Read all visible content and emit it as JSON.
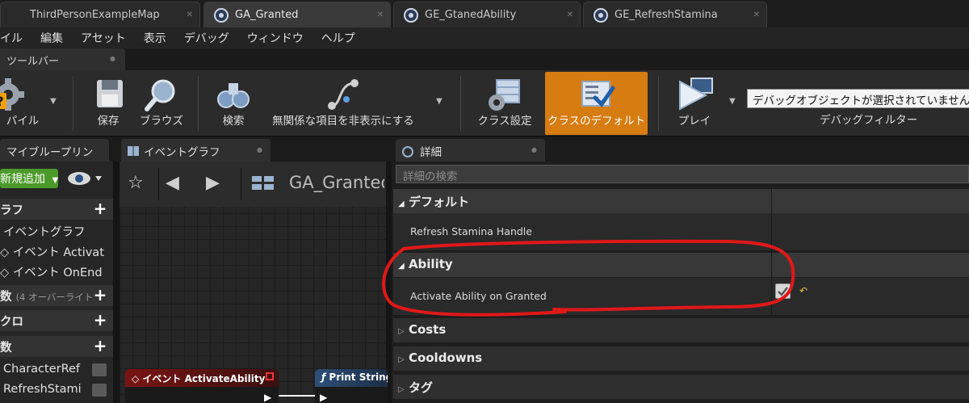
{
  "tabs": [
    {
      "label": "ThirdPersonExampleMap"
    },
    {
      "label": "GA_Granted"
    },
    {
      "label": "GE_GtanedAbility"
    },
    {
      "label": "GE_RefreshStamina"
    }
  ],
  "menu": [
    "イル",
    "編集",
    "アセット",
    "表示",
    "デバッグ",
    "ウィンドウ",
    "ヘルプ"
  ],
  "toolbar": {
    "title": "ツールバー",
    "compile_label": "パイル",
    "save_label": "保存",
    "browse_label": "ブラウズ",
    "find_label": "検索",
    "hide_unrelated_label": "無関係な項目を非表示にする",
    "class_settings_label": "クラス設定",
    "class_defaults_label": "クラスのデフォルト",
    "play_label": "プレイ",
    "debug_object_value": "デバッグオブジェクトが選択されていません",
    "debug_filter_label": "デバッグフィルター"
  },
  "my_blueprint": {
    "tab_label": "マイブループリン",
    "add_new_label": "新規追加",
    "graphs_label": "ラフ",
    "event_graph_label": "イベントグラフ",
    "event_activate_label": "イベント Activat",
    "event_onend_label": "イベント OnEnd",
    "functions_label": "数",
    "functions_sub": "(4 オーバーライト",
    "macros_label": "クロ",
    "variables_label": "数",
    "var_character_ref": "CharacterRef",
    "var_refresh_stamina": "RefreshStami"
  },
  "event_graph": {
    "tab_label": "イベントグラフ",
    "breadcrumb": "GA_Grantec",
    "node_event_label": "イベント ActivateAbility",
    "node_print_label": "Print String"
  },
  "details": {
    "tab_label": "詳細",
    "search_placeholder": "詳細の検索",
    "sections": {
      "default": "デフォルト",
      "ability": "Ability",
      "costs": "Costs",
      "cooldowns": "Cooldowns",
      "tags": "タグ"
    },
    "props": {
      "refresh_stamina_handle": "Refresh Stamina Handle",
      "activate_on_granted": "Activate Ability on Granted"
    },
    "activate_on_granted_value": true
  },
  "colors": {
    "accent_orange": "#d67c10",
    "add_green": "#4c9a2a",
    "annotation_red": "#e11818",
    "event_node_red": "#7a1414",
    "function_node_blue": "#2d4f78"
  }
}
